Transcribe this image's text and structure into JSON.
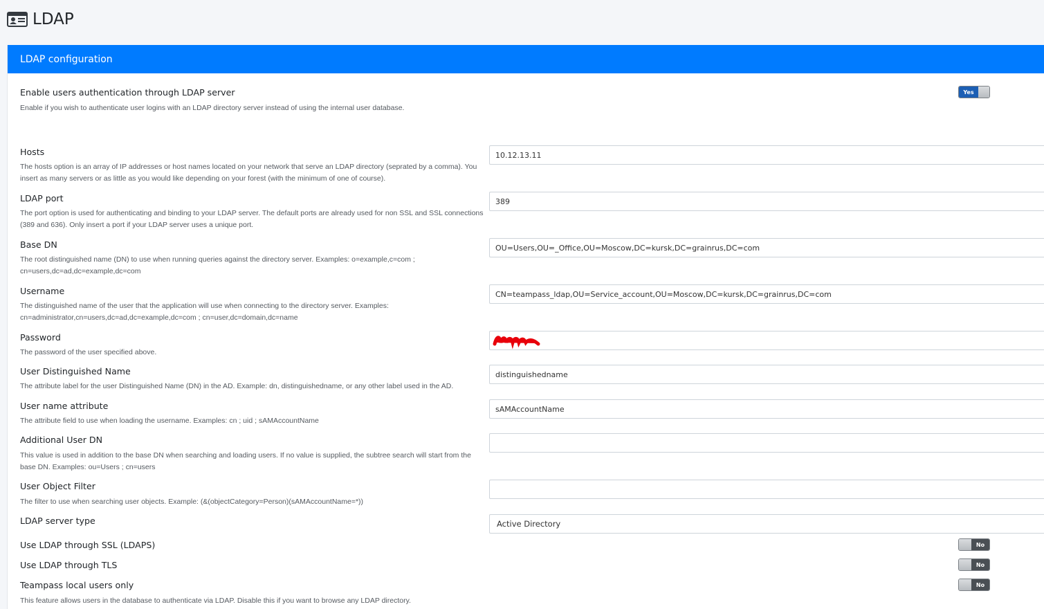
{
  "page": {
    "title": "LDAP",
    "header_icon": "id-card-icon"
  },
  "card": {
    "title": "LDAP configuration"
  },
  "colors": {
    "primary": "#007bff",
    "toggle_on": "#1c5fb4",
    "toggle_off": "#4a4f54",
    "redaction": "#e8000b"
  },
  "settings": {
    "enable": {
      "label": "Enable users authentication through LDAP server",
      "help": "Enable if you wish to authenticate user logins with an LDAP directory server instead of using the internal user database.",
      "toggle_label": "Yes"
    },
    "hosts": {
      "label": "Hosts",
      "help": "The hosts option is an array of IP addresses or host names located on your network that serve an LDAP directory (seprated by a comma). You insert as many servers or as little as you would like depending on your forest (with the minimum of one of course).",
      "value": "10.12.13.11"
    },
    "port": {
      "label": "LDAP port",
      "help": "The port option is used for authenticating and binding to your LDAP server. The default ports are already used for non SSL and SSL connections (389 and 636). Only insert a port if your LDAP server uses a unique port.",
      "value": "389"
    },
    "base_dn": {
      "label": "Base DN",
      "help": "The root distinguished name (DN) to use when running queries against the directory server. Examples: o=example,c=com ; cn=users,dc=ad,dc=example,dc=com",
      "value": "OU=Users,OU=_Office,OU=Moscow,DC=kursk,DC=grainrus,DC=com"
    },
    "username": {
      "label": "Username",
      "help": "The distinguished name of the user that the application will use when connecting to the directory server. Examples: cn=administrator,cn=users,dc=ad,dc=example,dc=com ; cn=user,dc=domain,dc=name",
      "value": "CN=teampass_ldap,OU=Service_account,OU=Moscow,DC=kursk,DC=grainrus,DC=com"
    },
    "password": {
      "label": "Password",
      "help": "The password of the user specified above.",
      "value": ""
    },
    "user_dn_attr": {
      "label": "User Distinguished Name",
      "help": "The attribute label for the user Distinguished Name (DN) in the AD. Example: dn, distinguishedname, or any other label used in the AD.",
      "value": "distinguishedname"
    },
    "user_name_attr": {
      "label": "User name attribute",
      "help": "The attribute field to use when loading the username. Examples: cn ; uid ; sAMAccountName",
      "value": "sAMAccountName"
    },
    "additional_dn": {
      "label": "Additional User DN",
      "help": "This value is used in addition to the base DN when searching and loading users. If no value is supplied, the subtree search will start from the base DN. Examples: ou=Users ; cn=users",
      "value": ""
    },
    "object_filter": {
      "label": "User Object Filter",
      "help": "The filter to use when searching user objects. Example: (&(objectCategory=Person)(sAMAccountName=*))",
      "value": ""
    },
    "server_type": {
      "label": "LDAP server type",
      "value": "Active Directory"
    },
    "ssl": {
      "label": "Use LDAP through SSL (LDAPS)",
      "toggle_label": "No"
    },
    "tls": {
      "label": "Use LDAP through TLS",
      "toggle_label": "No"
    },
    "local_only": {
      "label": "Teampass local users only",
      "help": "This feature allows users in the database to authenticate via LDAP. Disable this if you want to browse any LDAP directory.",
      "toggle_label": "No"
    }
  }
}
